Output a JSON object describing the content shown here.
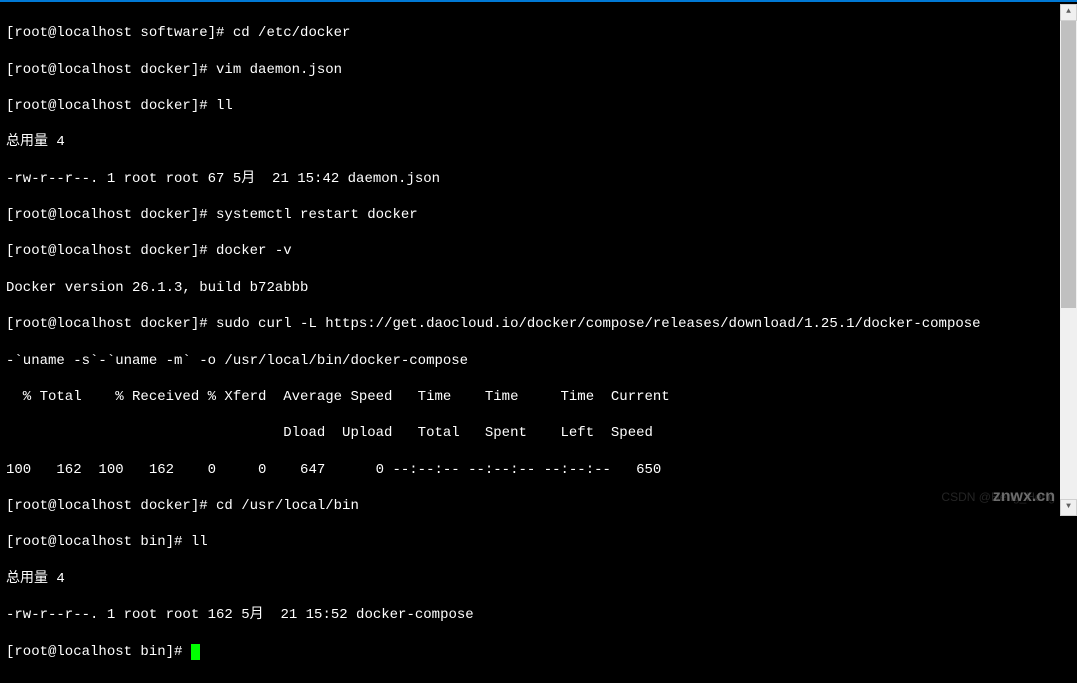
{
  "terminal": {
    "lines": [
      "[root@localhost software]# cd /etc/docker",
      "[root@localhost docker]# vim daemon.json",
      "[root@localhost docker]# ll",
      "总用量 4",
      "-rw-r--r--. 1 root root 67 5月  21 15:42 daemon.json",
      "[root@localhost docker]# systemctl restart docker",
      "[root@localhost docker]# docker -v",
      "Docker version 26.1.3, build b72abbb",
      "[root@localhost docker]# sudo curl -L https://get.daocloud.io/docker/compose/releases/download/1.25.1/docker-compose",
      "-`uname -s`-`uname -m` -o /usr/local/bin/docker-compose",
      "  % Total    % Received % Xferd  Average Speed   Time    Time     Time  Current",
      "                                 Dload  Upload   Total   Spent    Left  Speed",
      "100   162  100   162    0     0    647      0 --:--:-- --:--:-- --:--:--   650",
      "[root@localhost docker]# cd /usr/local/bin",
      "[root@localhost bin]# ll",
      "总用量 4",
      "-rw-r--r--. 1 root root 162 5月  21 15:52 docker-compose",
      "[root@localhost bin]# "
    ]
  },
  "watermark": {
    "main": "znwx.cn",
    "sub": "CSDN @Heng_Heng"
  },
  "scrollbar": {
    "up": "▲",
    "down": "▼"
  }
}
